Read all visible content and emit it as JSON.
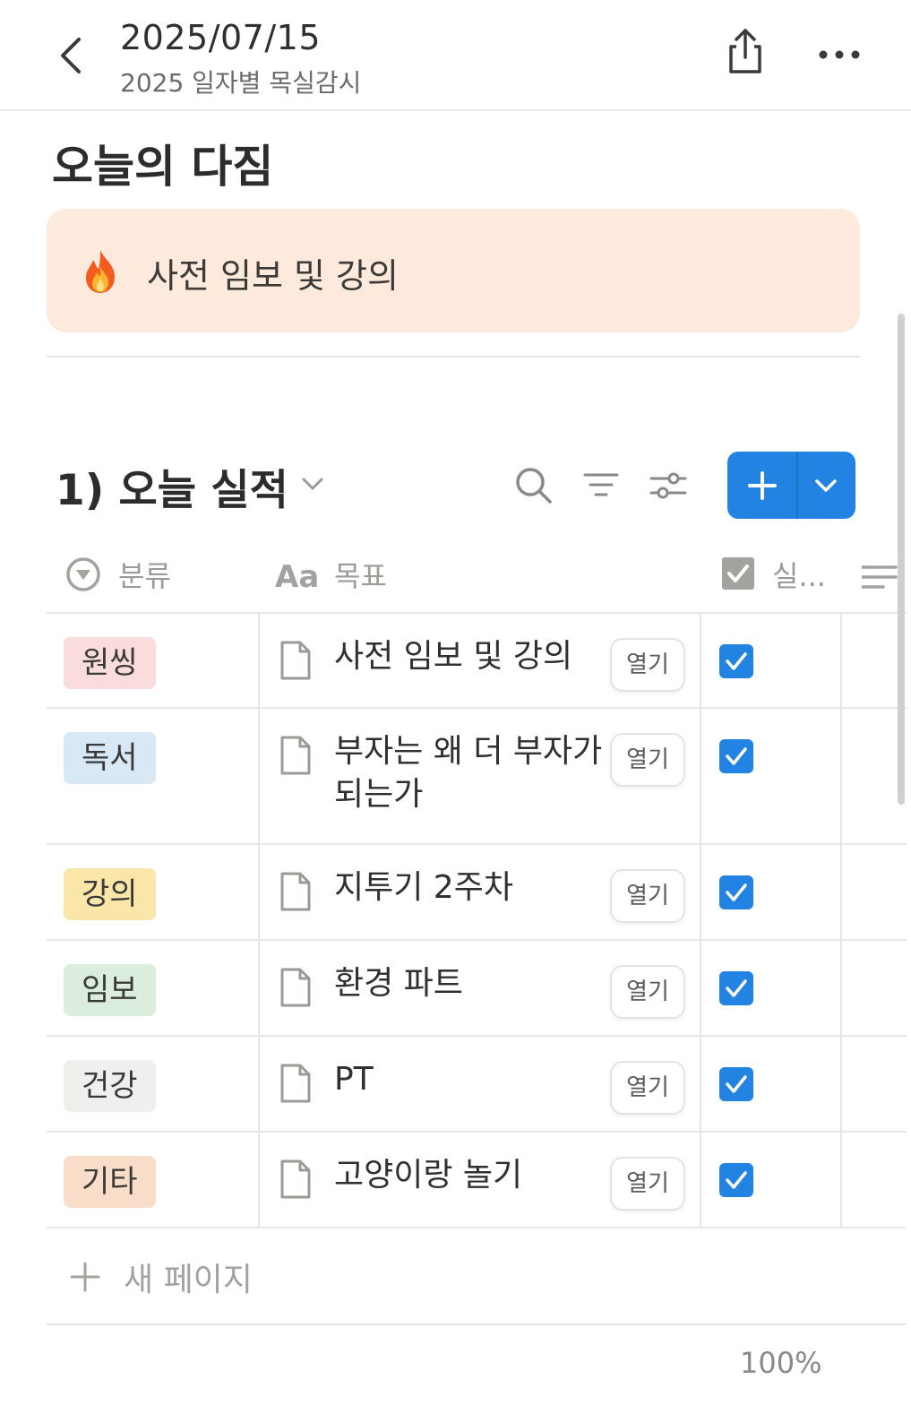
{
  "header": {
    "title": "2025/07/15",
    "subtitle": "2025 일자별 목실감시"
  },
  "page": {
    "heading": "오늘의 다짐",
    "callout": {
      "icon": "fire-emoji",
      "text": "사전 임보 및 강의"
    }
  },
  "database": {
    "title": "1) 오늘 실적",
    "columns": {
      "category": "분류",
      "goal": "목표",
      "done": "실..."
    },
    "open_label": "열기",
    "rows": [
      {
        "category": "원씽",
        "category_color": "#fbdcdc",
        "goal": "사전 임보 및 강의",
        "checked": true
      },
      {
        "category": "독서",
        "category_color": "#d9e8f5",
        "goal": "부자는 왜 더 부자가 되는가",
        "checked": true
      },
      {
        "category": "강의",
        "category_color": "#f9e6a8",
        "goal": "지투기 2주차",
        "checked": true
      },
      {
        "category": "임보",
        "category_color": "#dbeddc",
        "goal": "환경 파트",
        "checked": true
      },
      {
        "category": "건강",
        "category_color": "#efefed",
        "goal": "PT",
        "checked": true
      },
      {
        "category": "기타",
        "category_color": "#f9ddc9",
        "goal": "고양이랑 놀기",
        "checked": true
      }
    ],
    "new_page_label": "새 페이지",
    "progress_label": "100%"
  },
  "colors": {
    "accent": "#2383e2",
    "callout_bg": "#fdeadc"
  }
}
